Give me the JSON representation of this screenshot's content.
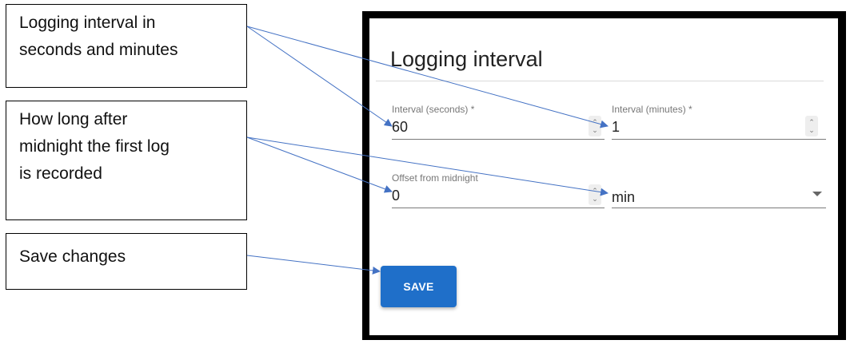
{
  "callouts": {
    "interval": [
      "Logging interval in",
      "seconds and minutes"
    ],
    "offset": [
      "How long after",
      "midnight the first log",
      "is recorded"
    ],
    "save": [
      "Save changes"
    ]
  },
  "panel": {
    "title": "Logging interval",
    "fields": {
      "seconds": {
        "label": "Interval (seconds) *",
        "value": "60"
      },
      "minutes": {
        "label": "Interval (minutes) *",
        "value": "1"
      },
      "offset": {
        "label": "Offset from midnight",
        "value": "0"
      },
      "unit": {
        "value": "min"
      }
    },
    "save_label": "SAVE"
  },
  "colors": {
    "arrow": "#4472c4",
    "button": "#1f6fc9",
    "frame": "#000000"
  }
}
